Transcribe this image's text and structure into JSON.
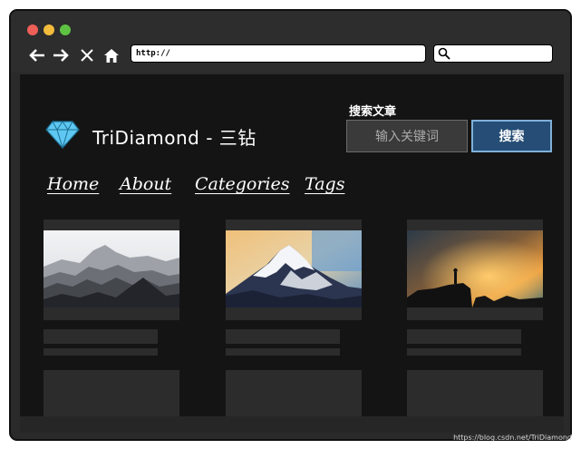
{
  "browser": {
    "address": "http://",
    "search_value": ""
  },
  "site": {
    "title": "TriDiamond - 三钻",
    "search_label": "搜索文章",
    "search_placeholder": "输入关键词",
    "search_button": "搜索"
  },
  "nav": {
    "items": [
      {
        "label": "Home"
      },
      {
        "label": "About"
      },
      {
        "label": "Categories"
      },
      {
        "label": "Tags"
      }
    ]
  },
  "cards": [
    {
      "image": "misty-mountains-photo"
    },
    {
      "image": "snow-peak-photo"
    },
    {
      "image": "silhouette-sunset-photo"
    }
  ],
  "watermark": "https://blog.csdn.net/TriDiamond",
  "colors": {
    "window_frame": "#2a2a2a",
    "content_bg": "#141414",
    "placeholder_block": "#2c2c2c",
    "search_button_bg": "#254d75",
    "search_button_border": "#7fb0d8",
    "diamond": "#5ec8f2"
  }
}
